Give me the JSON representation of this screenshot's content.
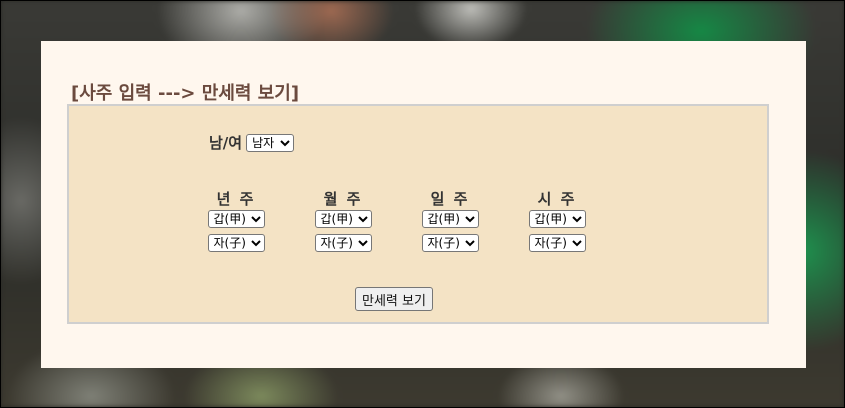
{
  "page": {
    "title": "[사주 입력 ---> 만세력 보기]"
  },
  "form": {
    "gender": {
      "label": "남/여",
      "selected": "남자"
    },
    "pillars": [
      {
        "label": "년 주",
        "stem": "갑(甲)",
        "branch": "자(子)"
      },
      {
        "label": "월 주",
        "stem": "갑(甲)",
        "branch": "자(子)"
      },
      {
        "label": "일 주",
        "stem": "갑(甲)",
        "branch": "자(子)"
      },
      {
        "label": "시 주",
        "stem": "갑(甲)",
        "branch": "자(子)"
      }
    ],
    "submit_label": "만세력 보기"
  },
  "colors": {
    "panel_bg": "#fff7ee",
    "form_bg": "#f4e3c5",
    "title": "#6b4a3e",
    "form_border": "#cfcfcf"
  },
  "icons": {
    "dropdown": "chevron-down-icon"
  }
}
